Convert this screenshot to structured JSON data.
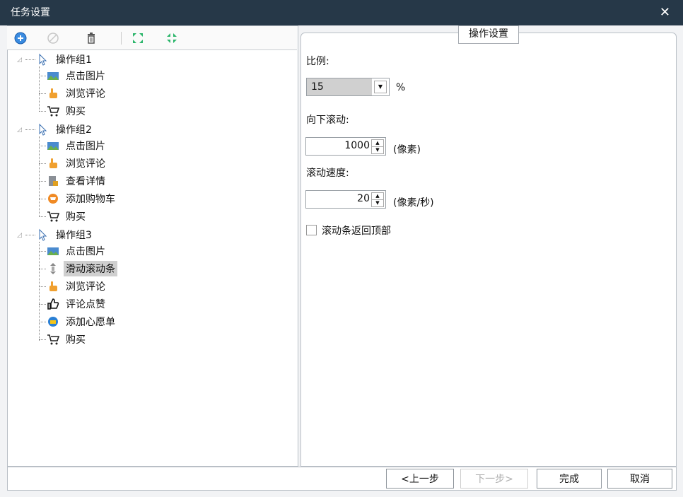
{
  "window": {
    "title": "任务设置",
    "close": "✕"
  },
  "toolbar": {
    "buttons": [
      {
        "name": "add-icon"
      },
      {
        "name": "disable-icon"
      },
      {
        "name": "delete-icon"
      },
      {
        "name": "expand-icon"
      },
      {
        "name": "collapse-icon"
      }
    ]
  },
  "tree": {
    "groups": [
      {
        "label": "操作组1",
        "items": [
          "点击图片",
          "浏览评论",
          "购买"
        ]
      },
      {
        "label": "操作组2",
        "items": [
          "点击图片",
          "浏览评论",
          "查看详情",
          "添加购物车",
          "购买"
        ]
      },
      {
        "label": "操作组3",
        "items": [
          "点击图片",
          "滑动滚动条",
          "浏览评论",
          "评论点赞",
          "添加心愿单",
          "购买"
        ]
      }
    ],
    "selected": "滑动滚动条"
  },
  "settings": {
    "legend": "操作设置",
    "ratio_label": "比例:",
    "ratio_value": "15",
    "ratio_unit": "%",
    "scroll_down_label": "向下滚动:",
    "scroll_down_value": "1000",
    "scroll_down_unit": "(像素)",
    "scroll_speed_label": "滚动速度:",
    "scroll_speed_value": "20",
    "scroll_speed_unit": "(像素/秒)",
    "return_top_label": "滚动条返回顶部",
    "return_top_checked": false
  },
  "footer": {
    "prev": "<上一步",
    "next": "下一步>",
    "finish": "完成",
    "cancel": "取消"
  },
  "colors": {
    "titlebar": "#263848",
    "accent": "#2a7fd4"
  }
}
